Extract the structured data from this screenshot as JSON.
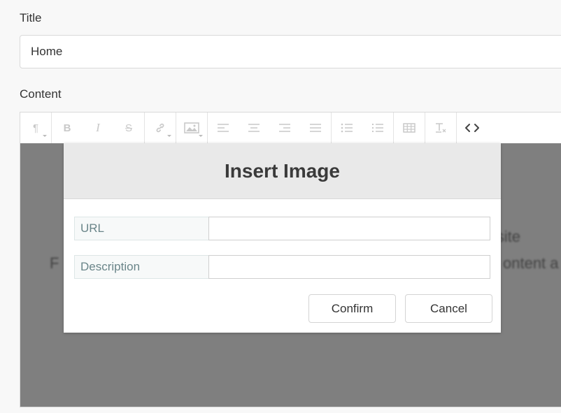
{
  "form": {
    "title_label": "Title",
    "title_value": "Home",
    "content_label": "Content"
  },
  "toolbar": {
    "icons": [
      "paragraph-icon",
      "bold-icon",
      "italic-icon",
      "strikethrough-icon",
      "link-icon",
      "image-icon",
      "align-left-icon",
      "align-center-icon",
      "align-right-icon",
      "align-justify-icon",
      "bullet-list-icon",
      "numbered-list-icon",
      "table-icon",
      "clear-format-icon",
      "code-view-icon"
    ],
    "paragraph_glyph": "¶",
    "bold_glyph": "B",
    "italic_glyph": "I",
    "strike_glyph": "S",
    "code_glyph": "<>"
  },
  "background_text": {
    "line1": "d website",
    "line2": "F",
    "line3": "ontent a"
  },
  "modal": {
    "title": "Insert Image",
    "url_label": "URL",
    "url_value": "",
    "description_label": "Description",
    "description_value": "",
    "confirm_label": "Confirm",
    "cancel_label": "Cancel"
  }
}
